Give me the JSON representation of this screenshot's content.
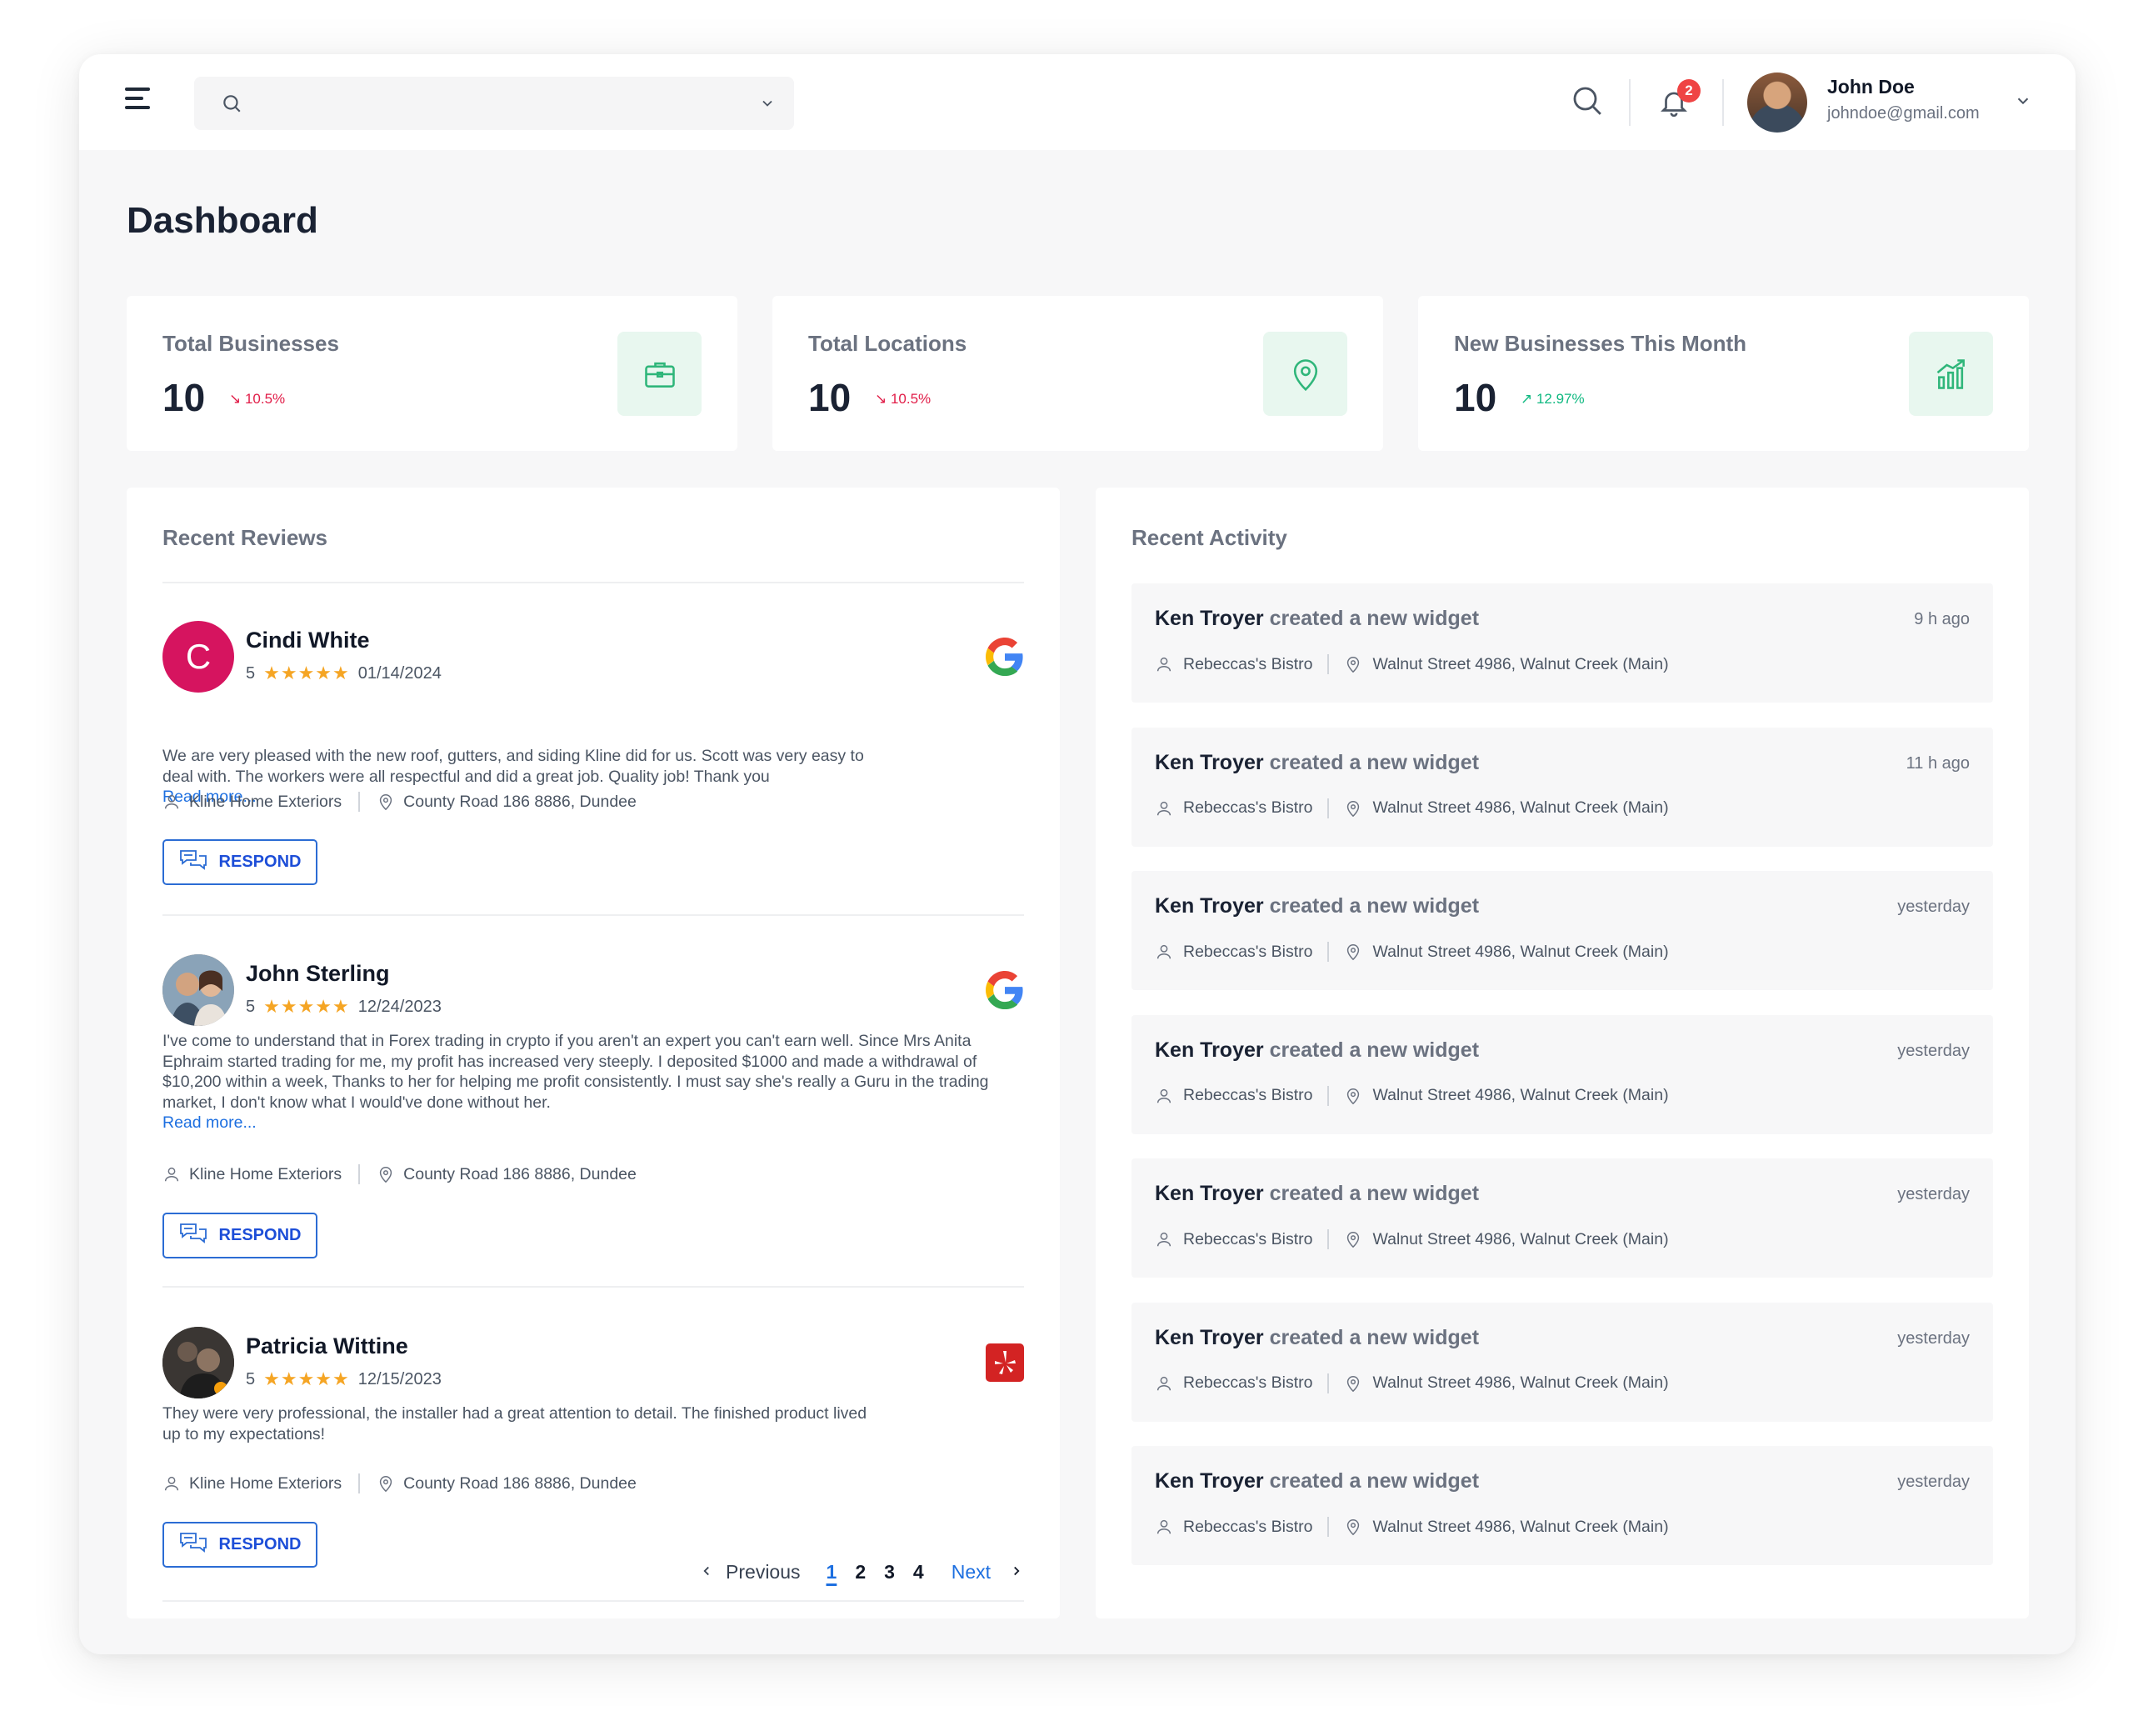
{
  "header": {
    "user_name": "John Doe",
    "user_email": "johndoe@gmail.com",
    "notification_count": "2"
  },
  "page": {
    "title": "Dashboard"
  },
  "stats": [
    {
      "label": "Total Businesses",
      "value": "10",
      "delta": "10.5%",
      "trend": "down",
      "icon": "briefcase-icon"
    },
    {
      "label": "Total Locations",
      "value": "10",
      "delta": "10.5%",
      "trend": "down",
      "icon": "map-pin-icon"
    },
    {
      "label": "New Businesses This Month",
      "value": "10",
      "delta": "12.97%",
      "trend": "up",
      "icon": "growth-chart-icon"
    }
  ],
  "reviews": {
    "title": "Recent Reviews",
    "respond_label": "RESPOND",
    "read_more": "Read more...",
    "items": [
      {
        "name": "Cindi White",
        "initial": "C",
        "rating": "5",
        "stars": "★★★★★",
        "date": "01/14/2024",
        "source": "google",
        "text": "We are very pleased with the new roof, gutters, and siding Kline did for us. Scott was very easy to deal with. The workers were all respectful and did a great job. Quality job! Thank you",
        "business": "Kline Home Exteriors",
        "location": "County Road 186 8886, Dundee"
      },
      {
        "name": "John Sterling",
        "initial": "",
        "rating": "5",
        "stars": "★★★★★",
        "date": "12/24/2023",
        "source": "google",
        "text": "I've come to understand that in Forex trading in crypto if you aren't an expert you can't earn well. Since Mrs Anita Ephraim started trading for me, my profit has increased very steeply. I deposited $1000 and made a withdrawal of $10,200 within a week, Thanks to her for helping me profit consistently. I must say she's really a Guru in the trading market, I don't know what I would've done without her.",
        "business": "Kline Home Exteriors",
        "location": "County Road 186 8886, Dundee"
      },
      {
        "name": "Patricia Wittine",
        "initial": "",
        "rating": "5",
        "stars": "★★★★★",
        "date": "12/15/2023",
        "source": "yelp",
        "text": "They were very professional, the installer had a great attention to detail. The finished product lived up to my expectations!",
        "business": "Kline Home Exteriors",
        "location": "County Road 186 8886, Dundee"
      }
    ],
    "pagination": {
      "previous": "Previous",
      "next": "Next",
      "pages": [
        "1",
        "2",
        "3",
        "4"
      ],
      "current": "1"
    }
  },
  "activity": {
    "title": "Recent Activity",
    "items": [
      {
        "who": "Ken Troyer",
        "action": "created a new widget",
        "time": "9 h ago",
        "business": "Rebeccas's Bistro",
        "location": "Walnut Street 4986, Walnut Creek (Main)"
      },
      {
        "who": "Ken Troyer",
        "action": "created a new widget",
        "time": "11 h ago",
        "business": "Rebeccas's Bistro",
        "location": "Walnut Street 4986, Walnut Creek (Main)"
      },
      {
        "who": "Ken Troyer",
        "action": "created a new widget",
        "time": "yesterday",
        "business": "Rebeccas's Bistro",
        "location": "Walnut Street 4986, Walnut Creek (Main)"
      },
      {
        "who": "Ken Troyer",
        "action": "created a new widget",
        "time": "yesterday",
        "business": "Rebeccas's Bistro",
        "location": "Walnut Street 4986, Walnut Creek (Main)"
      },
      {
        "who": "Ken Troyer",
        "action": "created a new widget",
        "time": "yesterday",
        "business": "Rebeccas's Bistro",
        "location": "Walnut Street 4986, Walnut Creek (Main)"
      },
      {
        "who": "Ken Troyer",
        "action": "created a new widget",
        "time": "yesterday",
        "business": "Rebeccas's Bistro",
        "location": "Walnut Street 4986, Walnut Creek (Main)"
      },
      {
        "who": "Ken Troyer",
        "action": "created a new widget",
        "time": "yesterday",
        "business": "Rebeccas's Bistro",
        "location": "Walnut Street 4986, Walnut Creek (Main)"
      }
    ]
  },
  "colors": {
    "accent": "#1d6fe0",
    "down": "#e11d48",
    "up": "#10b981",
    "icon_bg": "#e8f7ef",
    "star": "#f5a524"
  }
}
